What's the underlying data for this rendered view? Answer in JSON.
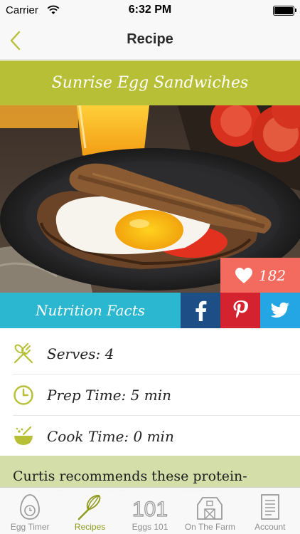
{
  "status_bar": {
    "carrier": "Carrier",
    "time": "6:32 PM",
    "battery_level": 1.0
  },
  "nav": {
    "title": "Recipe",
    "back_icon": "chevron-left-icon"
  },
  "recipe": {
    "name": "Sunrise Egg Sandwiches",
    "likes": "182",
    "nutrition_label": "Nutrition Facts",
    "serves": "Serves: 4",
    "prep_time": "Prep Time:  5 min",
    "cook_time": "Cook Time: 0 min",
    "description": "Curtis recommends these protein-packed sandwiches as a delicious way to start the day."
  },
  "share": [
    "facebook-icon",
    "pinterest-icon",
    "twitter-icon"
  ],
  "tabs": [
    {
      "label": "Egg Timer",
      "icon": "egg-timer-icon",
      "active": false
    },
    {
      "label": "Recipes",
      "icon": "whisk-icon",
      "active": true
    },
    {
      "label": "Eggs 101",
      "icon": "eggs-101-icon",
      "active": false
    },
    {
      "label": "On The Farm",
      "icon": "barn-icon",
      "active": false
    },
    {
      "label": "Account",
      "icon": "document-icon",
      "active": false
    }
  ],
  "colors": {
    "accent": "#b7bf36",
    "like": "#f26b5e",
    "nutrition": "#2bb7cf",
    "facebook": "#1d4e86",
    "pinterest": "#d5222f",
    "twitter": "#23a6e3",
    "description_bg": "#d4dea9"
  }
}
